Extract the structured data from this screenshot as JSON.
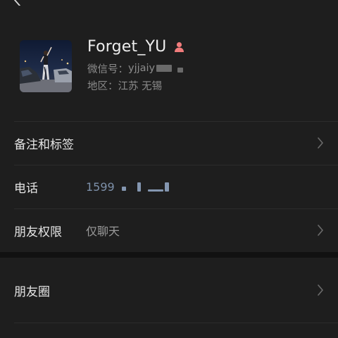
{
  "profile": {
    "nickname": "Forget_YU",
    "wechat_id_label": "微信号：",
    "wechat_id_prefix": "yjjaiy",
    "region_label": "地区：",
    "region_value": "江苏 无锡"
  },
  "rows": {
    "remarks": {
      "label": "备注和标签"
    },
    "phone": {
      "label": "电话",
      "value_prefix": "1599"
    },
    "privacy": {
      "label": "朋友权限",
      "value": "仅聊天"
    },
    "moments": {
      "label": "朋友圈"
    }
  },
  "icons": {
    "back": "chevron-left-icon",
    "gender": "person-icon",
    "row_arrow": "chevron-right-icon"
  },
  "colors": {
    "background": "#1e1e1e",
    "gender_icon": "#f07b7b",
    "phone_link": "#7d90a9",
    "section_gap": "#111111"
  }
}
